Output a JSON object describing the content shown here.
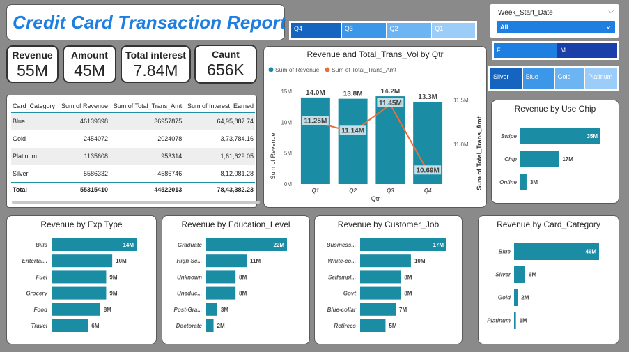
{
  "title": "Credit Card Transaction Report",
  "quarter_slicer": [
    "Q4",
    "Q3",
    "Q2",
    "Q1"
  ],
  "gender_slicer": [
    "F",
    "M"
  ],
  "category_slicer": [
    "Silver",
    "Blue",
    "Gold",
    "Platinum"
  ],
  "week_filter": {
    "title": "Week_Start_Date",
    "value": "All"
  },
  "kpis": [
    {
      "label": "Revenue",
      "value": "55M"
    },
    {
      "label": "Amount",
      "value": "45M"
    },
    {
      "label": "Total interest",
      "value": "7.84M"
    },
    {
      "label": "Caunt",
      "value": "656K"
    }
  ],
  "table": {
    "headers": [
      "Card_Category",
      "Sum of Revenue",
      "Sum of Total_Trans_Amt",
      "Sum of Interest_Earned"
    ],
    "rows": [
      [
        "Blue",
        "46139398",
        "36957875",
        "64,95,887.74"
      ],
      [
        "Gold",
        "2454072",
        "2024078",
        "3,73,784.16"
      ],
      [
        "Platinum",
        "1135608",
        "953314",
        "1,61,629.05"
      ],
      [
        "Silver",
        "5586332",
        "4586746",
        "8,12,081.28"
      ]
    ],
    "total": [
      "Total",
      "55315410",
      "44522013",
      "78,43,382.23"
    ]
  },
  "colors": {
    "bar": "#1a8ca3",
    "line": "#e8703a",
    "accent": "#1e7fe0"
  },
  "chart_data": [
    {
      "id": "qtr",
      "type": "bar",
      "title": "Revenue and Total_Trans_Vol by Qtr",
      "xlabel": "Qtr",
      "ylabel": "Sum of Revenue",
      "y2label": "Sum of Total_Trans_Amt",
      "categories": [
        "Q1",
        "Q2",
        "Q3",
        "Q4"
      ],
      "legend": [
        "Sum of Revenue",
        "Sum of Total_Trans_Amt"
      ],
      "ylim": [
        0,
        15
      ],
      "yticks": [
        "0M",
        "5M",
        "10M",
        "15M"
      ],
      "y2ticks": [
        "11.0M",
        "11.5M"
      ],
      "series": [
        {
          "name": "Sum of Revenue",
          "values": [
            14.0,
            13.8,
            14.2,
            13.3
          ],
          "labels": [
            "14.0M",
            "13.8M",
            "14.2M",
            "13.3M"
          ]
        },
        {
          "name": "Sum of Total_Trans_Amt",
          "values": [
            11.25,
            11.14,
            11.45,
            10.69
          ],
          "labels": [
            "11.25M",
            "11.14M",
            "11.45M",
            "10.69M"
          ]
        }
      ]
    },
    {
      "id": "chip",
      "type": "bar",
      "title": "Revenue by Use Chip",
      "categories": [
        "Swipe",
        "Chip",
        "Online"
      ],
      "values": [
        35,
        17,
        3
      ],
      "labels": [
        "35M",
        "17M",
        "3M"
      ]
    },
    {
      "id": "exp",
      "type": "bar",
      "title": "Revenue by Exp Type",
      "categories": [
        "Bills",
        "Entertai...",
        "Fuel",
        "Grocery",
        "Food",
        "Travel"
      ],
      "values": [
        14,
        10,
        9,
        9,
        8,
        6
      ],
      "labels": [
        "14M",
        "10M",
        "9M",
        "9M",
        "8M",
        "6M"
      ]
    },
    {
      "id": "edu",
      "type": "bar",
      "title": "Revenue by Education_Level",
      "categories": [
        "Graduate",
        "High Sc...",
        "Unknown",
        "Uneduc...",
        "Post-Gra...",
        "Doctorate"
      ],
      "values": [
        22,
        11,
        8,
        8,
        3,
        2
      ],
      "labels": [
        "22M",
        "11M",
        "8M",
        "8M",
        "3M",
        "2M"
      ]
    },
    {
      "id": "job",
      "type": "bar",
      "title": "Revenue by Customer_Job",
      "categories": [
        "Business...",
        "White-co...",
        "Selfempl...",
        "Govt",
        "Blue-collar",
        "Retirees"
      ],
      "values": [
        17,
        10,
        8,
        8,
        7,
        5
      ],
      "labels": [
        "17M",
        "10M",
        "8M",
        "8M",
        "7M",
        "5M"
      ]
    },
    {
      "id": "cat",
      "type": "bar",
      "title": "Revenue by Card_Category",
      "categories": [
        "Blue",
        "Silver",
        "Gold",
        "Platinum"
      ],
      "values": [
        46,
        6,
        2,
        1
      ],
      "labels": [
        "46M",
        "6M",
        "2M",
        "1M"
      ]
    }
  ]
}
